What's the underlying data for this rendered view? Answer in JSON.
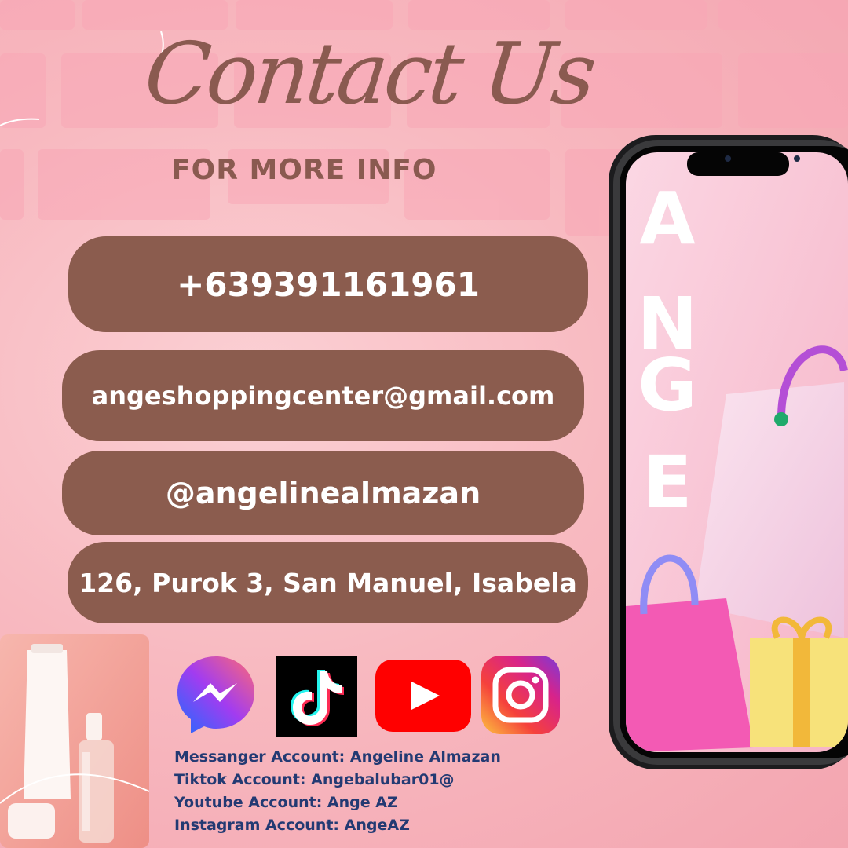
{
  "header": {
    "title": "Contact Us",
    "subtitle": "FOR MORE INFO"
  },
  "contacts": {
    "phone": "+639391161961",
    "email": "angeshoppingcenter@gmail.com",
    "handle": "@angelinealmazan",
    "address": "126, Purok 3, San Manuel, Isabela"
  },
  "social_icons": [
    "messenger-icon",
    "tiktok-icon",
    "youtube-icon",
    "instagram-icon"
  ],
  "accounts": [
    "Messanger Account:  Angeline Almazan",
    "Tiktok Account: Angebalubar01@",
    "Youtube Account: Ange AZ",
    "Instagram Account: AngeAZ"
  ],
  "phone_mockup": {
    "letters": [
      "A",
      "N",
      "G",
      "E"
    ]
  },
  "colors": {
    "pill": "#8b5c4e",
    "heading": "#8a5a50",
    "accounts_text": "#233a73",
    "background": "#f8b9c0"
  }
}
